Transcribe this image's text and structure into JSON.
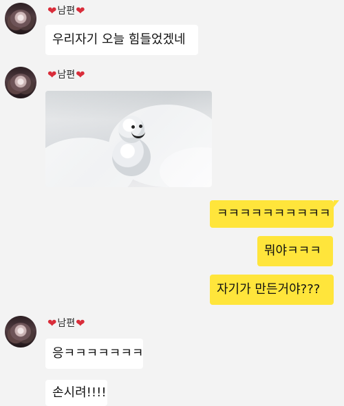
{
  "chat": {
    "sender_name": "남편",
    "messages": [
      {
        "type": "text",
        "side": "left",
        "text": "우리자기 오늘 힘들었겠네"
      },
      {
        "type": "image",
        "side": "left",
        "image_name": "snowman-photo"
      },
      {
        "type": "text",
        "side": "right",
        "text": "ㅋㅋㅋㅋㅋㅋㅋㅋㅋㅋ"
      },
      {
        "type": "text",
        "side": "right",
        "text": "뭐야ㅋㅋㅋ"
      },
      {
        "type": "text",
        "side": "right",
        "text": "자기가 만든거야???"
      },
      {
        "type": "text",
        "side": "left",
        "text": "응ㅋㅋㅋㅋㅋㅋㅋ"
      },
      {
        "type": "text",
        "side": "left",
        "text": "손시려!!!!"
      }
    ]
  },
  "icons": {
    "heart": "heart-icon",
    "avatar": "avatar"
  },
  "colors": {
    "background": "#f3f3f3",
    "incoming_bubble": "#ffffff",
    "outgoing_bubble": "#ffe53b",
    "heart": "#d92d3a"
  }
}
